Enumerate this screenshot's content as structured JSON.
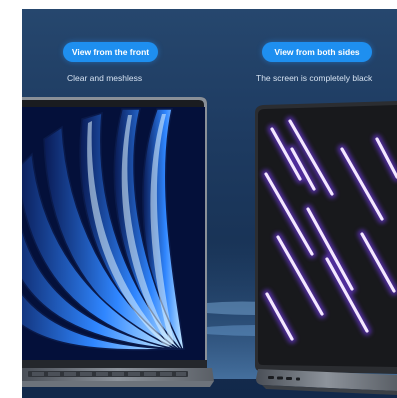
{
  "left_panel": {
    "badge": "View from the front",
    "caption": "Clear and meshless"
  },
  "right_panel": {
    "badge": "View from both sides",
    "caption": "The screen is completely black"
  },
  "colors": {
    "badge_bg": "#1e8ff0",
    "background": "#1d3a60",
    "privacy_glow": "#a45cff"
  },
  "icons": [
    "laptop-front-view",
    "laptop-side-view",
    "wallpaper-blue-petals"
  ]
}
